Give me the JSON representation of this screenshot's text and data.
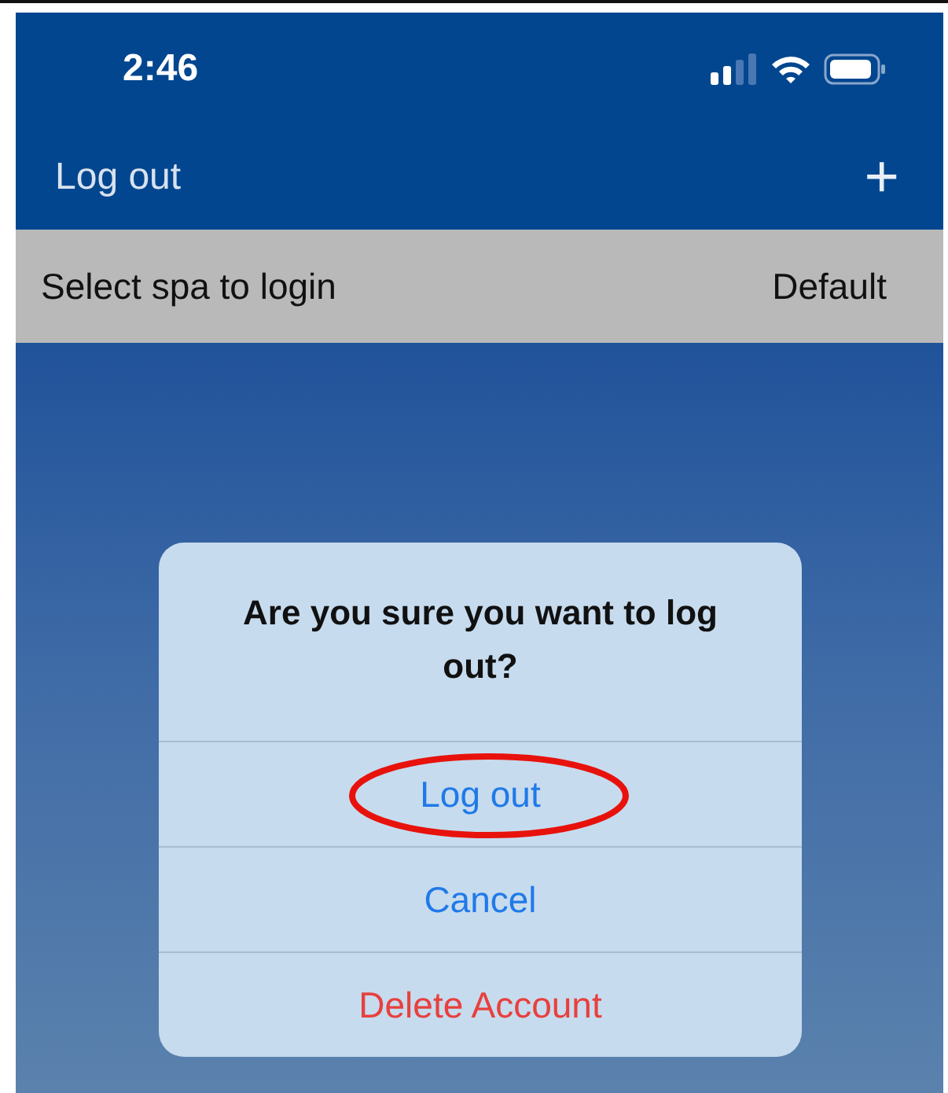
{
  "status_bar": {
    "time": "2:46"
  },
  "nav_bar": {
    "back_label": "Log out",
    "add_symbol": "+"
  },
  "spa_selector": {
    "label": "Select spa to login",
    "value": "Default"
  },
  "alert": {
    "title": "Are you sure you want to log out?",
    "actions": [
      {
        "label": "Log out",
        "kind": "default",
        "circled": true
      },
      {
        "label": "Cancel",
        "kind": "default",
        "circled": false
      },
      {
        "label": "Delete Account",
        "kind": "destructive",
        "circled": false
      }
    ]
  }
}
